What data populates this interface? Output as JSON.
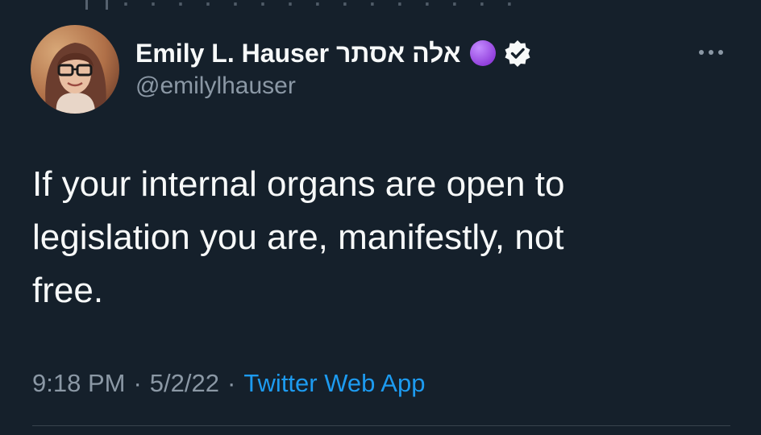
{
  "author": {
    "display_name": "Emily L. Hauser אלה אסתר",
    "handle": "@emilylhauser",
    "avatar_icon": "avatar-photo",
    "name_emoji_icon": "purple-circle-icon",
    "verified_icon": "verified-badge-icon"
  },
  "tweet": {
    "text": "If your internal organs are open to\nlegislation you are, manifestly, not\nfree.",
    "time": "9:18 PM",
    "date": "5/2/22",
    "separator": "·",
    "source": "Twitter Web App"
  },
  "colors": {
    "background": "#15202b",
    "text": "#f7f9f9",
    "secondary": "#8b98a5",
    "link": "#1d9bf0",
    "divider": "#38444d",
    "purple_circle": "#9b4fd8"
  },
  "more_icon": "more-options-icon"
}
